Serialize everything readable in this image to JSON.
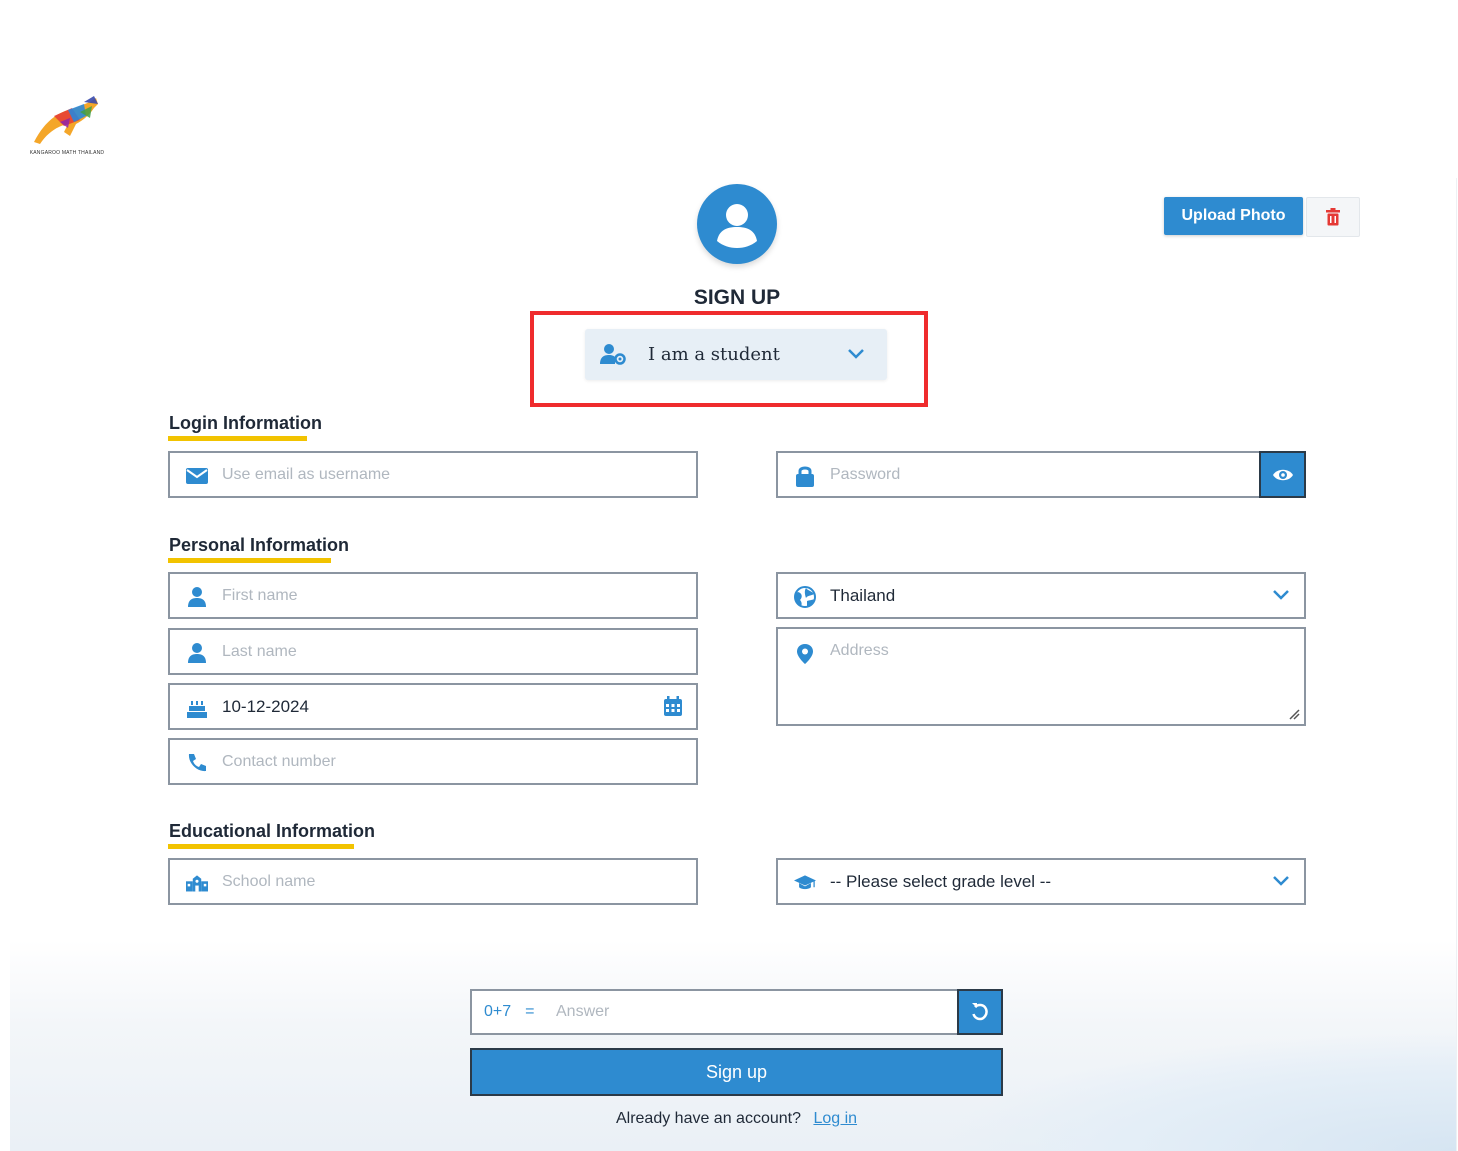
{
  "logo": {
    "caption": "KANGAROO MATH THAILAND"
  },
  "header": {
    "title": "SIGN UP"
  },
  "photo": {
    "upload_label": "Upload Photo"
  },
  "role": {
    "selected": "I am a student"
  },
  "sections": {
    "login": "Login Information",
    "personal": "Personal Information",
    "education": "Educational Information"
  },
  "login": {
    "email_placeholder": "Use email as username",
    "password_placeholder": "Password"
  },
  "personal": {
    "first_name_placeholder": "First name",
    "last_name_placeholder": "Last name",
    "birth_date_value": "10-12-2024",
    "contact_placeholder": "Contact number",
    "country_selected": "Thailand",
    "address_placeholder": "Address"
  },
  "education": {
    "school_placeholder": "School name",
    "grade_selected": "-- Please select grade level --"
  },
  "captcha": {
    "question": "0+7",
    "equals": "=",
    "answer_placeholder": "Answer"
  },
  "actions": {
    "signup_label": "Sign up",
    "have_account_text": "Already have an account?",
    "login_link": "Log in"
  },
  "colors": {
    "primary": "#2e8bd0",
    "accent_underline": "#f2c300",
    "highlight_border": "#ef2b2d",
    "delete_icon": "#e53935"
  }
}
